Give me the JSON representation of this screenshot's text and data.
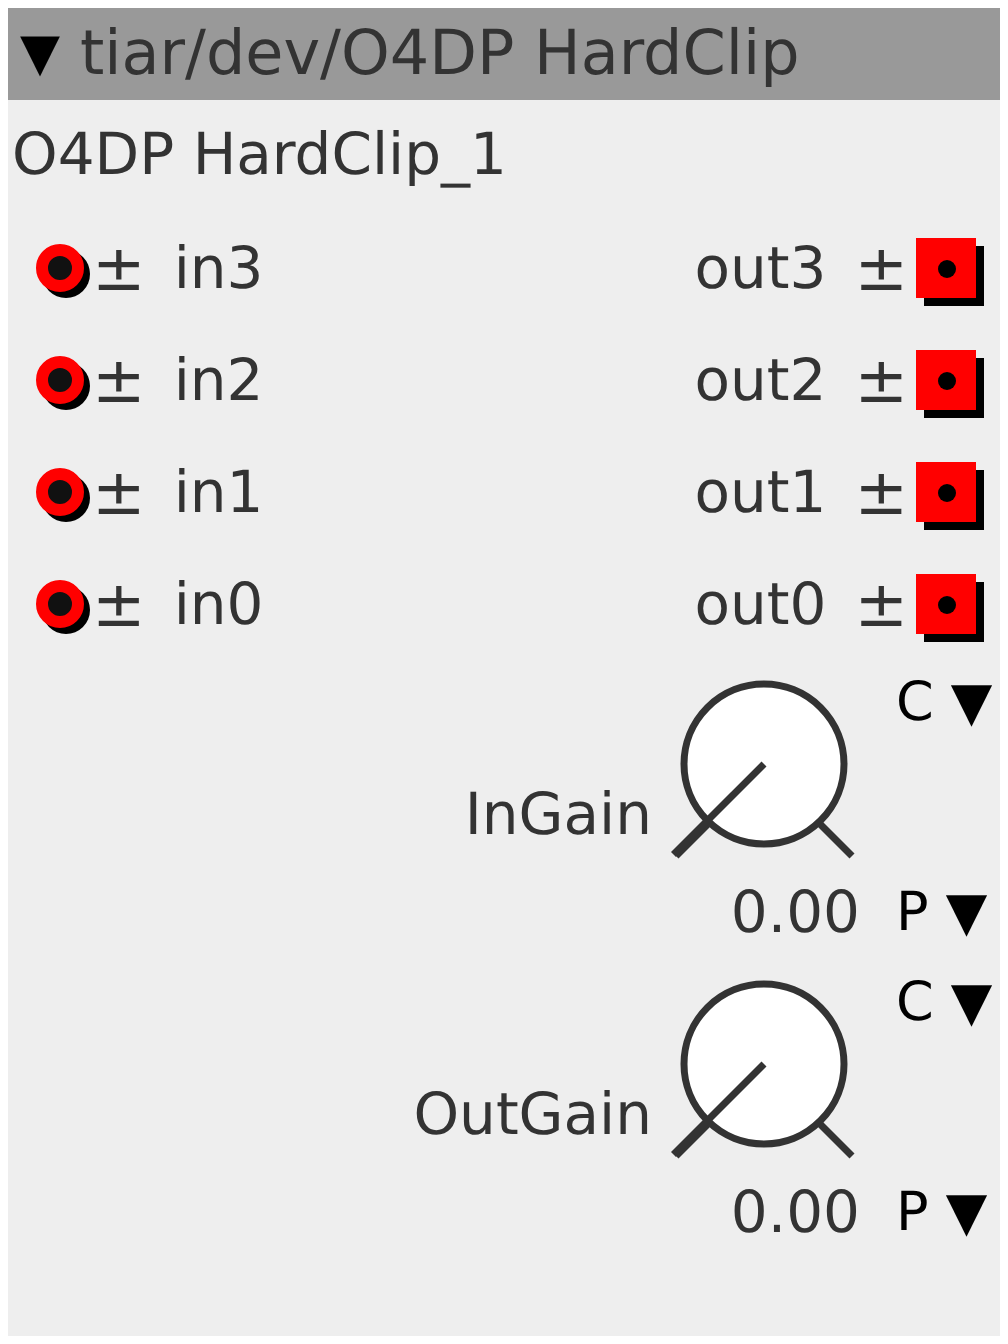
{
  "object": {
    "collapse_glyph": "▼",
    "type_path": "tiar/dev/O4DP HardClip",
    "instance_name": "O4DP HardClip_1"
  },
  "inlets": [
    {
      "name": "in3",
      "sign": "±"
    },
    {
      "name": "in2",
      "sign": "±"
    },
    {
      "name": "in1",
      "sign": "±"
    },
    {
      "name": "in0",
      "sign": "±"
    }
  ],
  "outlets": [
    {
      "name": "out3",
      "sign": "±"
    },
    {
      "name": "out2",
      "sign": "±"
    },
    {
      "name": "out1",
      "sign": "±"
    },
    {
      "name": "out0",
      "sign": "±"
    }
  ],
  "params": [
    {
      "label": "InGain",
      "value": "0.00",
      "top_menu": "C ▼",
      "bottom_menu": "P ▼"
    },
    {
      "label": "OutGain",
      "value": "0.00",
      "top_menu": "C ▼",
      "bottom_menu": "P ▼"
    }
  ]
}
